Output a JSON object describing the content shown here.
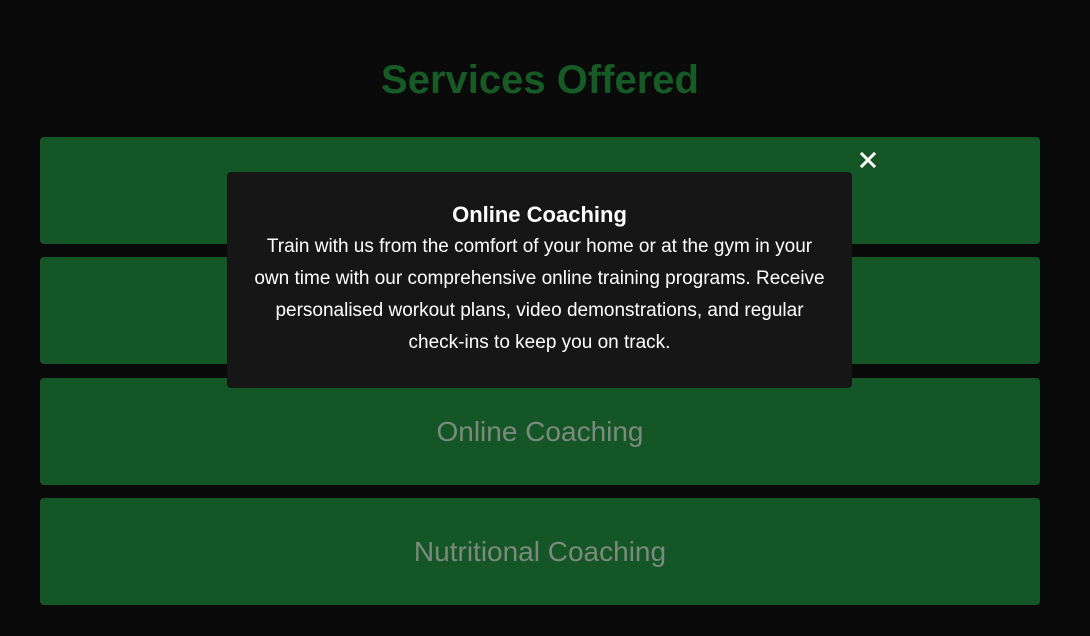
{
  "page": {
    "heading": "Services Offered"
  },
  "services": [
    {
      "label": ""
    },
    {
      "label": ""
    },
    {
      "label": "Online Coaching"
    },
    {
      "label": "Nutritional Coaching"
    }
  ],
  "modal": {
    "title": "Online Coaching",
    "body": "Train with us from the comfort of your home or at the gym in your own time with our comprehensive online training programs. Receive personalised workout plans, video demonstrations, and regular check-ins to keep you on track.",
    "close_icon": "close-icon"
  },
  "colors": {
    "background": "#0a0a0a",
    "heading": "#165a26",
    "card": "#155626",
    "card_text": "#7a8a7c",
    "modal_bg": "#161616",
    "modal_text": "#ffffff"
  }
}
